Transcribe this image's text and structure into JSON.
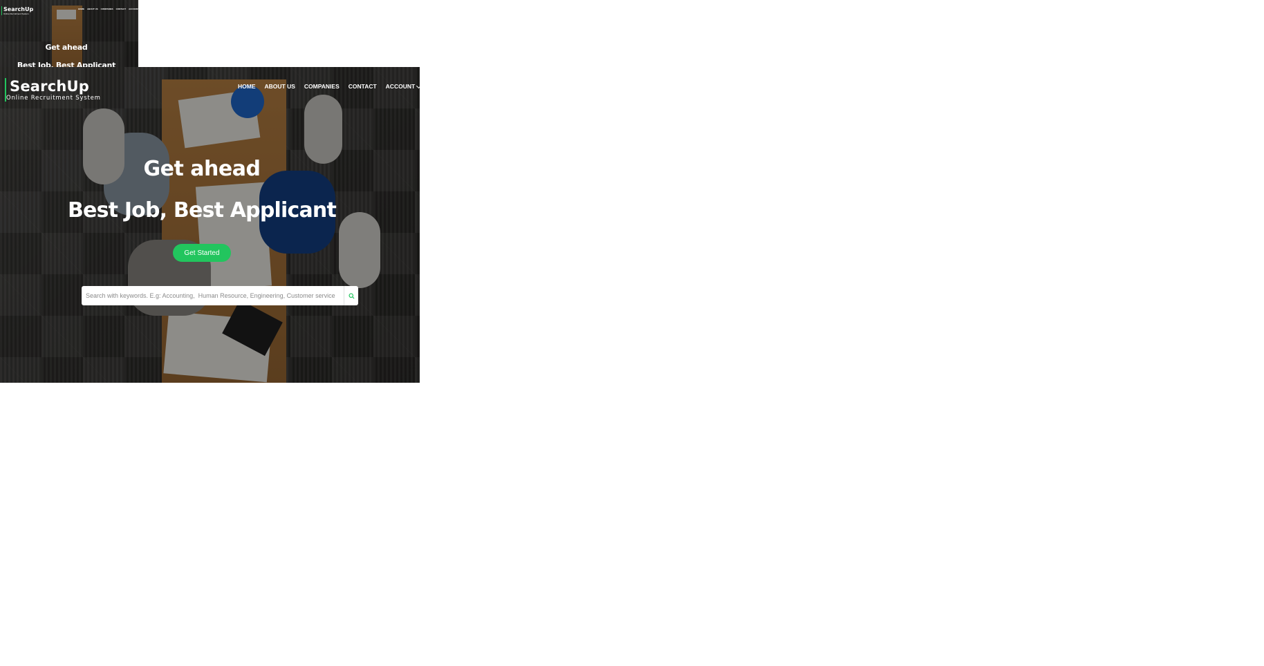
{
  "brand": {
    "name": "SearchUp",
    "tagline": "Online Recruitment System"
  },
  "nav": {
    "home": "HOME",
    "about": "ABOUT US",
    "companies": "COMPANIES",
    "contact": "CONTACT",
    "account": "ACCOUNT"
  },
  "hero": {
    "headline": "Get ahead",
    "subheadline": "Best Job, Best Applicant",
    "cta_label": "Get Started"
  },
  "search": {
    "placeholder": "Search with keywords. E.g: Accounting,  Human Resource, Engineering, Customer service",
    "value": ""
  },
  "colors": {
    "accent": "#22c55e",
    "overlay": "#000000"
  },
  "icons": {
    "search": "search-icon",
    "account_dropdown": "chevron-down-icon"
  }
}
